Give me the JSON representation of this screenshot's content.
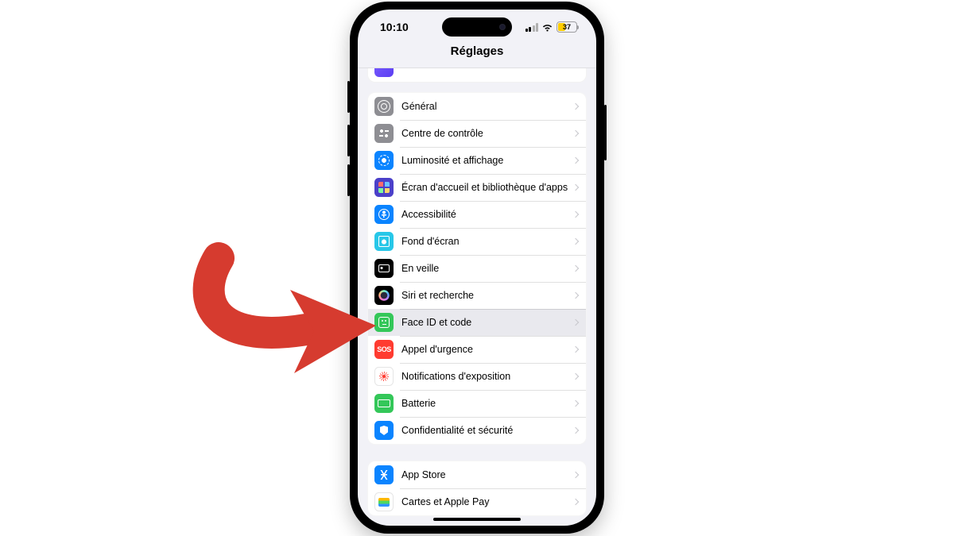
{
  "status": {
    "time": "10:10",
    "battery_pct": "37",
    "signal_bars_active": 2,
    "signal_bars_total": 4
  },
  "navbar": {
    "title": "Réglages"
  },
  "groups": {
    "main": {
      "general": "Général",
      "control_center": "Centre de contrôle",
      "display": "Luminosité et affichage",
      "home": "Écran d'accueil et bibliothèque d'apps",
      "accessibility": "Accessibilité",
      "wallpaper": "Fond d'écran",
      "standby": "En veille",
      "siri": "Siri et recherche",
      "faceid": "Face ID et code",
      "sos": "Appel d'urgence",
      "sos_icon_text": "SOS",
      "exposure": "Notifications d'exposition",
      "battery": "Batterie",
      "privacy": "Confidentialité et sécurité"
    },
    "store": {
      "appstore": "App Store",
      "wallet": "Cartes et Apple Pay"
    }
  },
  "annotation": {
    "arrow_color": "#d63b2f",
    "target": "faceid"
  }
}
